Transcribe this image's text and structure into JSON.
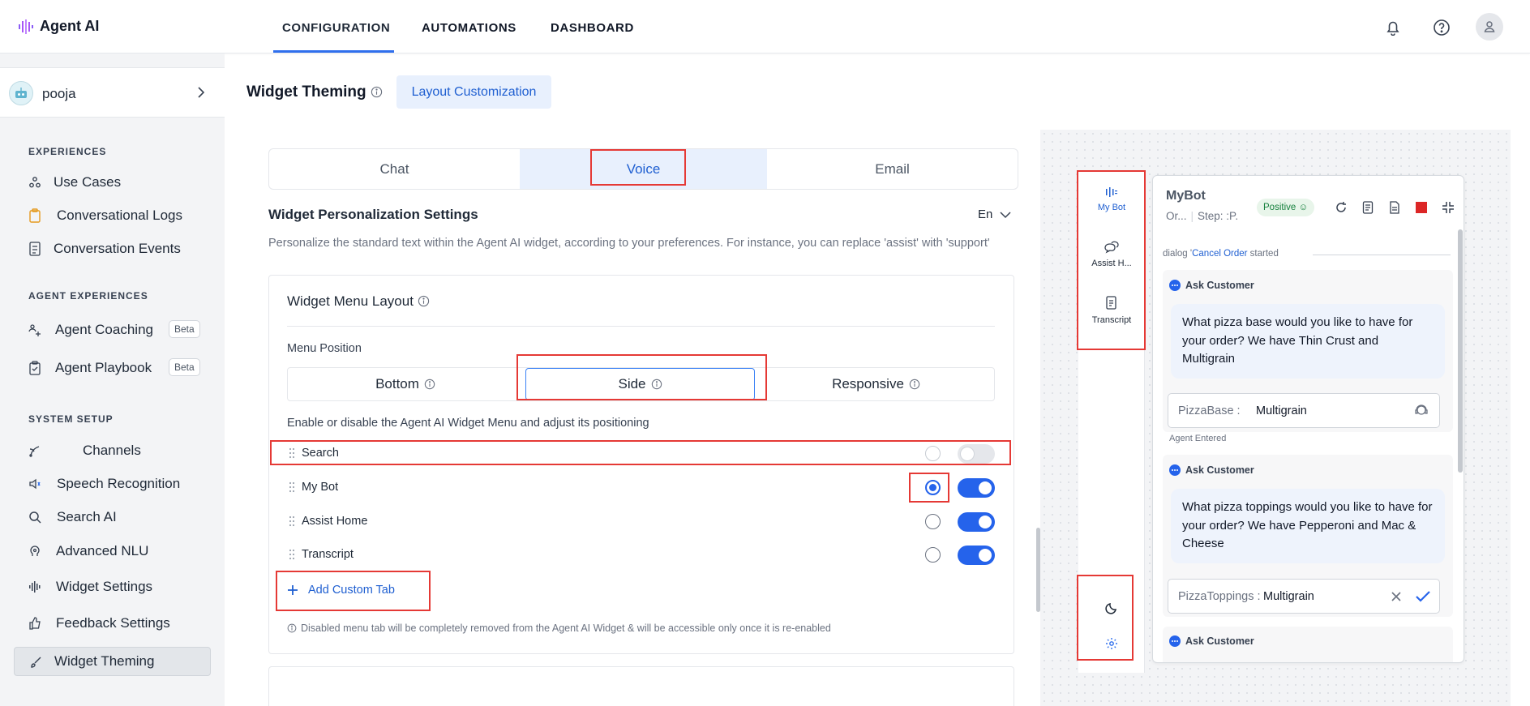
{
  "app": {
    "logo_text": "Agent AI"
  },
  "nav": {
    "tabs": [
      {
        "label": "CONFIGURATION",
        "active": true
      },
      {
        "label": "AUTOMATIONS"
      },
      {
        "label": "DASHBOARD"
      }
    ],
    "icons": [
      "bell-icon",
      "help-icon",
      "user-icon"
    ]
  },
  "sidebar": {
    "workspace": "pooja",
    "sections": [
      {
        "title": "EXPERIENCES",
        "items": [
          "Use Cases",
          "Conversational Logs",
          "Conversation Events"
        ]
      },
      {
        "title": "AGENT EXPERIENCES",
        "items": [
          "Agent Coaching",
          "Agent Playbook"
        ]
      },
      {
        "title": "SYSTEM SETUP",
        "items": [
          "Channels",
          "Speech Recognition",
          "Search AI",
          "Advanced NLU",
          "Widget Settings",
          "Feedback Settings",
          "Widget Theming"
        ]
      }
    ],
    "badge": "Beta",
    "active_item": "Widget Theming"
  },
  "header": {
    "title": "Widget Theming",
    "tab": "Layout Customization"
  },
  "channels": {
    "tabs": [
      "Chat",
      "Voice",
      "Email"
    ],
    "active": "Voice"
  },
  "personalization": {
    "title": "Widget Personalization Settings",
    "language": "En",
    "description": "Personalize the standard text within the Agent AI widget, according to your preferences. For instance, you can replace 'assist' with 'support'"
  },
  "menu_layout": {
    "title": "Widget Menu Layout",
    "position_label": "Menu Position",
    "positions": [
      "Bottom",
      "Side",
      "Responsive"
    ],
    "active_position": "Side",
    "enable_text": "Enable or disable the Agent AI Widget Menu and adjust its positioning",
    "items": [
      {
        "label": "Search",
        "default": false,
        "enabled": false
      },
      {
        "label": "My Bot",
        "default": true,
        "enabled": true
      },
      {
        "label": "Assist Home",
        "default": false,
        "enabled": true
      },
      {
        "label": "Transcript",
        "default": false,
        "enabled": true
      }
    ],
    "add_tab": "Add Custom Tab",
    "note": "Disabled menu tab will be completely removed from the Agent AI Widget & will be accessible only once it is re-enabled"
  },
  "preview": {
    "rail": [
      {
        "label": "My Bot",
        "active": true
      },
      {
        "label": "Assist H..."
      },
      {
        "label": "Transcript"
      }
    ],
    "widget": {
      "name": "MyBot",
      "sub_left": "Or...",
      "sub_step": "Step: :P.",
      "sentiment": "Positive",
      "dialog_prefix": "dialog '",
      "dialog_name": "Cancel Order",
      "dialog_suffix": " started",
      "ask_label": "Ask Customer",
      "messages": [
        "What pizza base would you like to have for your order? We have Thin Crust and Multigrain",
        "What pizza toppings would you like to have for your order? We have Pepperoni and Mac & Cheese"
      ],
      "slots": [
        {
          "key": "PizzaBase",
          "value": "Multigrain"
        },
        {
          "key": "PizzaToppings",
          "value": "Multigrain"
        }
      ],
      "agent_entered": "Agent Entered"
    }
  },
  "colors": {
    "accent": "#2f6fed",
    "highlight": "#e53935",
    "active_bg": "#e8f0fd"
  }
}
